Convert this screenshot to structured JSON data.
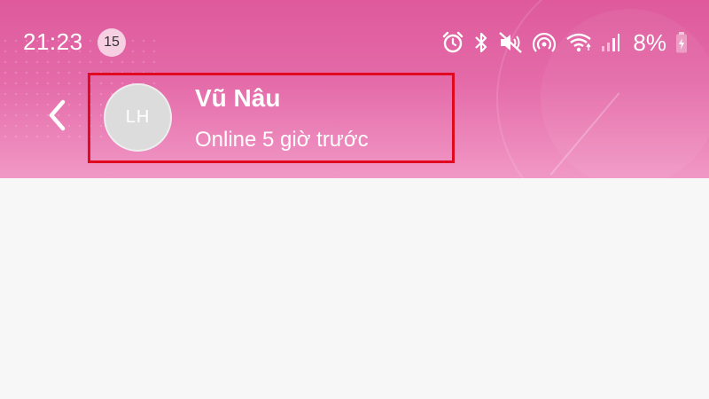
{
  "status_bar": {
    "time": "21:23",
    "notification_count": "15",
    "battery": "8%",
    "icons": [
      "alarm-icon",
      "bluetooth-icon",
      "mute-icon",
      "hotspot-icon",
      "wifi-icon",
      "signal-icon",
      "battery-charging-icon"
    ]
  },
  "header": {
    "back_icon": "chevron-left-icon",
    "avatar_initials": "LH",
    "contact_name": "Vũ Nâu",
    "last_seen": "Online 5 giờ trước"
  },
  "colors": {
    "header_gradient_top": "#de5a9c",
    "header_gradient_bottom": "#f198c6",
    "highlight_border": "#e0091f",
    "background": "#f7f7f7"
  }
}
